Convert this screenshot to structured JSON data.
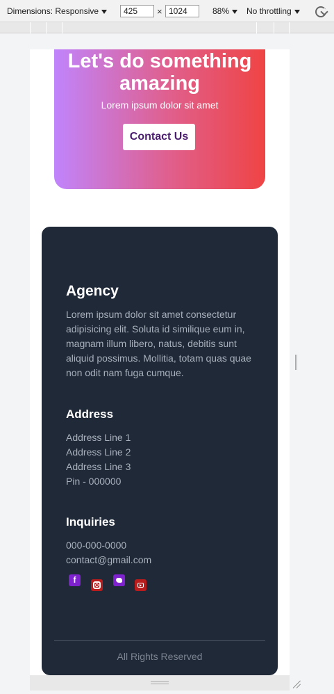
{
  "devtools": {
    "dimensions_label": "Dimensions: Responsive",
    "width_value": "425",
    "times_symbol": "×",
    "height_value": "1024",
    "zoom_label": "88%",
    "throttling_label": "No throttling",
    "rotate_icon": "rotate-icon"
  },
  "cta": {
    "title": "Let's do something amazing",
    "subtitle": "Lorem ipsum dolor sit amet",
    "button_label": "Contact Us",
    "gradient_colors": [
      "#c084fc",
      "#e05f8c",
      "#ef4444"
    ]
  },
  "footer": {
    "agency": {
      "title": "Agency",
      "description": "Lorem ipsum dolor sit amet consectetur adipisicing elit. Soluta id similique eum in, magnam illum libero, natus, debitis sunt aliquid possimus. Mollitia, totam quas quae non odit nam fuga cumque."
    },
    "address": {
      "title": "Address",
      "lines": [
        "Address Line 1",
        "Address Line 2",
        "Address Line 3",
        "Pin - 000000"
      ]
    },
    "inquiries": {
      "title": "Inquiries",
      "phone": "000-000-0000",
      "email": "contact@gmail.com"
    },
    "social": [
      {
        "name": "facebook-icon",
        "glyph": "f",
        "color": "#7e22ce"
      },
      {
        "name": "instagram-icon",
        "glyph": "",
        "color": "#b91c1c"
      },
      {
        "name": "twitter-icon",
        "glyph": "",
        "color": "#7e22ce"
      },
      {
        "name": "youtube-icon",
        "glyph": "",
        "color": "#b91c1c"
      }
    ],
    "copyright": "All Rights Reserved",
    "background_color": "#202938"
  }
}
